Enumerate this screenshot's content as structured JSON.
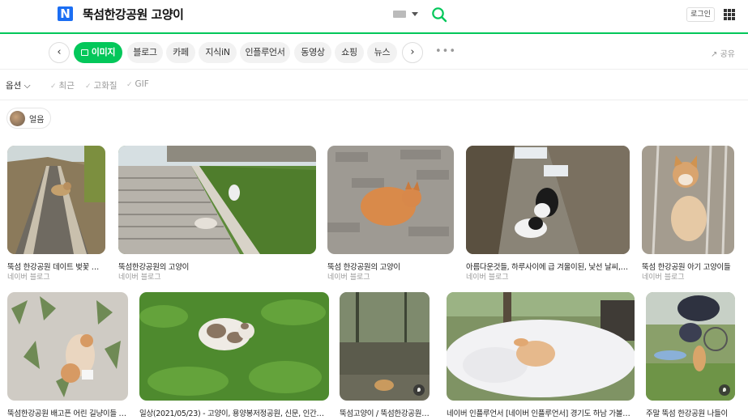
{
  "header": {
    "logo_letter": "N",
    "query": "뚝섬한강공원 고양이",
    "login_label": "로그인"
  },
  "tabs": [
    {
      "label": "이미지",
      "active": true
    },
    {
      "label": "블로그"
    },
    {
      "label": "카페"
    },
    {
      "label": "지식iN"
    },
    {
      "label": "인플루언서"
    },
    {
      "label": "동영상"
    },
    {
      "label": "쇼핑"
    },
    {
      "label": "뉴스"
    }
  ],
  "toolbar": {
    "prev_label": "‹",
    "next_label": "›",
    "more_label": "•••",
    "share_label": "공유"
  },
  "options": {
    "label": "옵션",
    "filters": [
      "최근",
      "고화질",
      "GIF"
    ]
  },
  "chip": {
    "label": "얼음"
  },
  "results": [
    {
      "caption": "뚝섬 한강공원 데이트 벚꽃 구경...",
      "source": "네이버 블로그"
    },
    {
      "caption": "뚝섬한강공원의 고양이",
      "source": "네이버 블로그"
    },
    {
      "caption": "뚝섬 한강공원의 고양이",
      "source": "네이버 블로그"
    },
    {
      "caption": "아름다운것들, 하루사이에 급 겨울이된, 낯선 날씨, 어...",
      "source": "네이버 블로그"
    },
    {
      "caption": "뚝섬 한강공원 아기 고양이들",
      "source": "네이버 블로그"
    },
    {
      "caption": "뚝섬한강공원 배고픈 어린 길냥이들 ㅠ ...",
      "source": "네이버 블로그"
    },
    {
      "caption": "일상(2021/05/23) - 고양이, 용양봉저정공원, 신문, 인간의지...",
      "source": "네이버 블로그"
    },
    {
      "caption": "뚝섬고양이 / 뚝섬한강공원 / ...",
      "source": "네이버 블로그"
    },
    {
      "caption": "네이버 인플루언서 [네이버 인플루언서] 경기도 하남 가볼만한...",
      "source": "네이버 블로그"
    },
    {
      "caption": "주말 뚝섬 한강공원 나들이",
      "source": "네이버 블로그"
    }
  ],
  "colors": {
    "brand_green": "#03c75a",
    "logo_blue": "#1b6ef3"
  }
}
